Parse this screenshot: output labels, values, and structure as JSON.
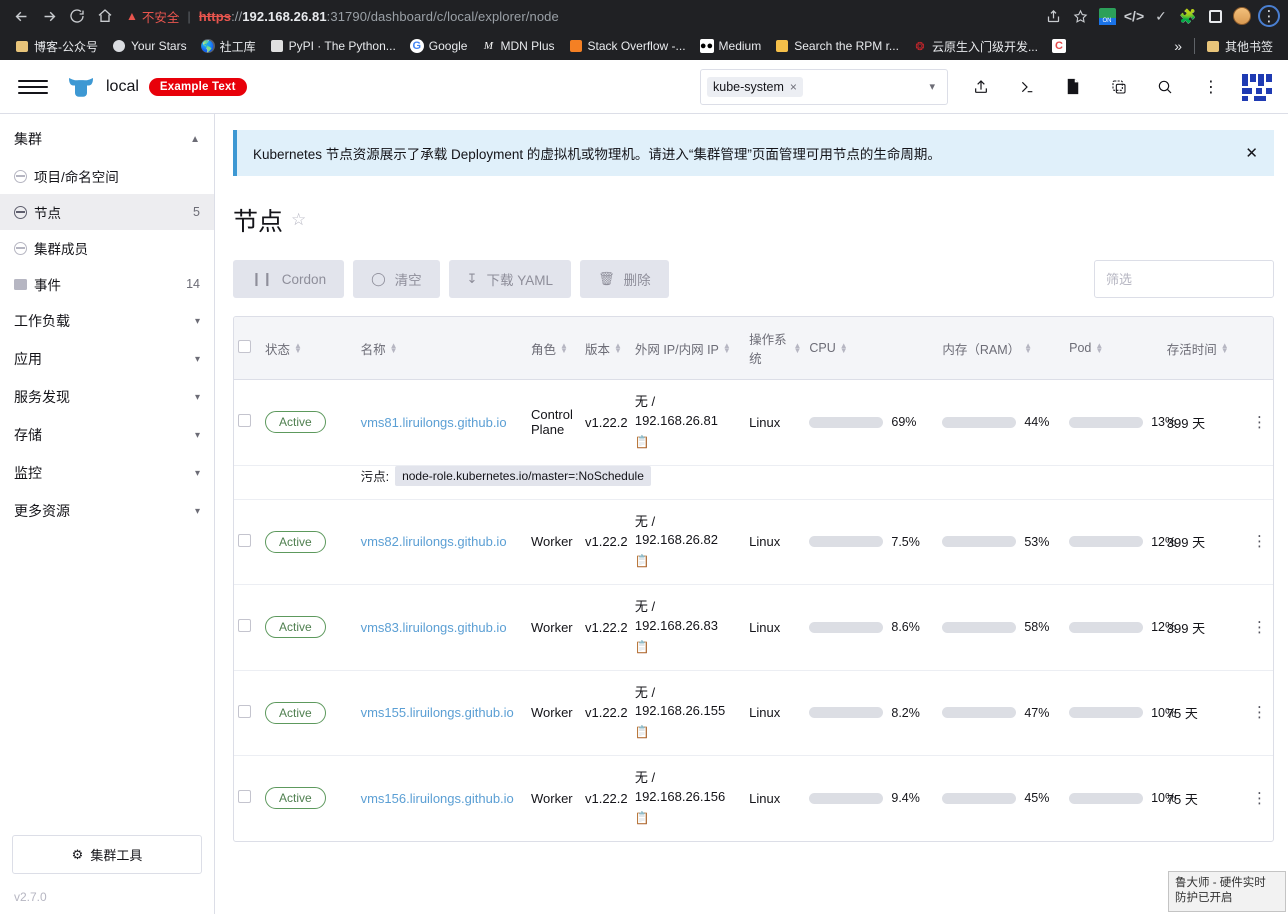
{
  "browser": {
    "nav": {
      "back_icon": "back-arrow-icon",
      "forward_icon": "forward-arrow-icon",
      "reload_icon": "reload-icon",
      "home_icon": "home-icon"
    },
    "security_warning": "不安全",
    "url_scheme": "https",
    "url_separator": "://",
    "url_host": "192.168.26.81",
    "url_path": ":31790/dashboard/c/local/explorer/node",
    "omnibox_icons": [
      "share-icon",
      "bookmark-star-icon",
      "extension-on-icon",
      "extension-code-icon",
      "extension-check-icon",
      "extensions-puzzle-icon",
      "side-panel-icon",
      "profile-avatar-icon",
      "browser-menu-icon"
    ],
    "bookmarks": [
      {
        "label": "博客-公众号",
        "icon": "folder-icon"
      },
      {
        "label": "Your Stars",
        "icon": "circle-icon"
      },
      {
        "label": "社工库",
        "icon": "globe-icon"
      },
      {
        "label": "PyPI · The Python...",
        "icon": "cube-icon"
      },
      {
        "label": "Google",
        "icon": "google-icon"
      },
      {
        "label": "MDN Plus",
        "icon": "mdn-icon"
      },
      {
        "label": "Stack Overflow -...",
        "icon": "stackoverflow-icon"
      },
      {
        "label": "Medium",
        "icon": "medium-icon"
      },
      {
        "label": "Search the RPM r...",
        "icon": "rpm-icon"
      },
      {
        "label": "云原生入门级开发...",
        "icon": "huawei-icon"
      },
      {
        "label": "",
        "icon": "c-icon"
      }
    ],
    "bookmarks_overflow": "»",
    "other_bookmarks": "其他书签"
  },
  "topnav": {
    "menu_icon": "hamburger-menu-icon",
    "logo_icon": "rancher-cow-logo-icon",
    "cluster_name": "local",
    "badge": "Example Text",
    "namespace_chip": "kube-system",
    "namespace_chip_close": "×",
    "namespace_caret": "chevron-down-icon",
    "icons": [
      "import-yaml-icon",
      "kubectl-shell-icon",
      "file-icon",
      "copy-kubeconfig-icon",
      "search-icon",
      "vertical-dots-icon"
    ],
    "brand_logo": "suse-logo-icon"
  },
  "sidebar": {
    "groups": [
      {
        "label": "集群",
        "expanded": true,
        "chevron": "chevron-up-icon",
        "items": [
          {
            "label": "项目/命名空间",
            "icon": "namespace-icon",
            "count": "",
            "active": false
          },
          {
            "label": "节点",
            "icon": "node-icon",
            "count": "5",
            "active": true
          },
          {
            "label": "集群成员",
            "icon": "members-icon",
            "count": "",
            "active": false
          },
          {
            "label": "事件",
            "icon": "folder-icon",
            "count": "14",
            "active": false
          }
        ]
      },
      {
        "label": "工作负载",
        "expanded": false,
        "chevron": "chevron-down-icon",
        "items": []
      },
      {
        "label": "应用",
        "expanded": false,
        "chevron": "chevron-down-icon",
        "items": []
      },
      {
        "label": "服务发现",
        "expanded": false,
        "chevron": "chevron-down-icon",
        "items": []
      },
      {
        "label": "存储",
        "expanded": false,
        "chevron": "chevron-down-icon",
        "items": []
      },
      {
        "label": "监控",
        "expanded": false,
        "chevron": "chevron-down-icon",
        "items": []
      },
      {
        "label": "更多资源",
        "expanded": false,
        "chevron": "chevron-down-icon",
        "items": []
      }
    ],
    "cluster_tools_label": "集群工具",
    "cluster_tools_icon": "gear-icon",
    "version": "v2.7.0"
  },
  "main": {
    "banner": {
      "text": "Kubernetes 节点资源展示了承载 Deployment 的虚拟机或物理机。请进入“集群管理”页面管理可用节点的生命周期。",
      "close_icon": "close-icon"
    },
    "page_title": "节点",
    "favorite_icon": "star-outline-icon",
    "toolbar": [
      {
        "label": "Cordon",
        "icon": "pause-icon"
      },
      {
        "label": "清空",
        "icon": "circle-icon"
      },
      {
        "label": "下载 YAML",
        "icon": "download-icon"
      },
      {
        "label": "删除",
        "icon": "trash-icon"
      }
    ],
    "filter_placeholder": "筛选",
    "table": {
      "columns": [
        {
          "label": "状态",
          "sortable": true
        },
        {
          "label": "名称",
          "sortable": true
        },
        {
          "label": "角色",
          "sortable": true
        },
        {
          "label": "版本",
          "sortable": true
        },
        {
          "label": "外网 IP/内网 IP",
          "sortable": true
        },
        {
          "label": "操作系统",
          "sortable": true
        },
        {
          "label": "CPU",
          "sortable": true
        },
        {
          "label": "内存（RAM）",
          "sortable": true
        },
        {
          "label": "Pod",
          "sortable": true
        },
        {
          "label": "存活时间",
          "sortable": true
        }
      ],
      "rows": [
        {
          "state": "Active",
          "name": "vms81.liruilongs.github.io",
          "role": "Control Plane",
          "version": "v1.22.2",
          "external_ip": "无 /",
          "internal_ip": "192.168.26.81",
          "os": "Linux",
          "cpu_pct": "69%",
          "cpu_value": 69,
          "ram_pct": "44%",
          "ram_value": 44,
          "pod_pct": "13%",
          "pod_value": 13,
          "age": "399 天",
          "taint_label": "污点:",
          "taint_value": "node-role.kubernetes.io/master=:NoSchedule"
        },
        {
          "state": "Active",
          "name": "vms82.liruilongs.github.io",
          "role": "Worker",
          "version": "v1.22.2",
          "external_ip": "无 /",
          "internal_ip": "192.168.26.82",
          "os": "Linux",
          "cpu_pct": "7.5%",
          "cpu_value": 7.5,
          "ram_pct": "53%",
          "ram_value": 53,
          "pod_pct": "12%",
          "pod_value": 12,
          "age": "399 天",
          "taint_label": "",
          "taint_value": ""
        },
        {
          "state": "Active",
          "name": "vms83.liruilongs.github.io",
          "role": "Worker",
          "version": "v1.22.2",
          "external_ip": "无 /",
          "internal_ip": "192.168.26.83",
          "os": "Linux",
          "cpu_pct": "8.6%",
          "cpu_value": 8.6,
          "ram_pct": "58%",
          "ram_value": 58,
          "pod_pct": "12%",
          "pod_value": 12,
          "age": "399 天",
          "taint_label": "",
          "taint_value": ""
        },
        {
          "state": "Active",
          "name": "vms155.liruilongs.github.io",
          "role": "Worker",
          "version": "v1.22.2",
          "external_ip": "无 /",
          "internal_ip": "192.168.26.155",
          "os": "Linux",
          "cpu_pct": "8.2%",
          "cpu_value": 8.2,
          "ram_pct": "47%",
          "ram_value": 47,
          "pod_pct": "10%",
          "pod_value": 10,
          "age": "75 天",
          "taint_label": "",
          "taint_value": ""
        },
        {
          "state": "Active",
          "name": "vms156.liruilongs.github.io",
          "role": "Worker",
          "version": "v1.22.2",
          "external_ip": "无 /",
          "internal_ip": "192.168.26.156",
          "os": "Linux",
          "cpu_pct": "9.4%",
          "cpu_value": 9.4,
          "ram_pct": "45%",
          "ram_value": 45,
          "pod_pct": "10%",
          "pod_value": 10,
          "age": "75 天",
          "taint_label": "",
          "taint_value": ""
        }
      ]
    }
  },
  "toast": {
    "line1": "鲁大师 - 硬件实时",
    "line2": "防护已开启"
  },
  "colors": {
    "accent_blue": "#3d98d3",
    "badge_red": "#e8000a",
    "link_blue": "#5b9fd4",
    "banner_bg": "#e0f0fa",
    "active_green": "#4f7f4f"
  }
}
